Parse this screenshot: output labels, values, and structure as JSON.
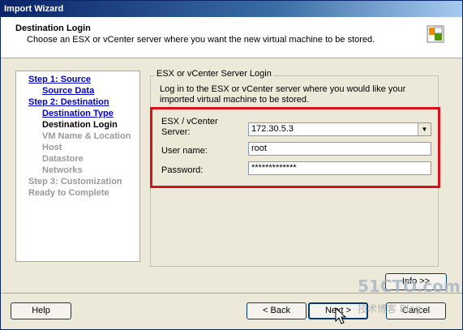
{
  "window": {
    "title": "Import Wizard"
  },
  "header": {
    "title": "Destination Login",
    "subtitle": "Choose an ESX or vCenter server where you want the new virtual machine to be stored."
  },
  "steps": [
    {
      "label": "Step 1: Source",
      "state": "link"
    },
    {
      "label": "Source Data",
      "state": "link"
    },
    {
      "label": "Step 2: Destination",
      "state": "link"
    },
    {
      "label": "Destination Type",
      "state": "link"
    },
    {
      "label": "Destination Login",
      "state": "current"
    },
    {
      "label": "VM Name & Location",
      "state": "disabled"
    },
    {
      "label": "Host",
      "state": "disabled"
    },
    {
      "label": "Datastore",
      "state": "disabled"
    },
    {
      "label": "Networks",
      "state": "disabled"
    },
    {
      "label": "Step 3: Customization",
      "state": "disabled"
    },
    {
      "label": "Ready to Complete",
      "state": "disabled"
    }
  ],
  "login": {
    "group_title": "ESX or vCenter Server Login",
    "description": "Log in to the ESX or vCenter server where you would like your imported virtual machine to be stored.",
    "server_label_1": "ESX / vCenter",
    "server_label_2": "Server:",
    "server_value": "172.30.5.3",
    "username_label": "User name:",
    "username_value": "root",
    "password_label": "Password:",
    "password_value": "*************"
  },
  "buttons": {
    "info": "Info >>",
    "help": "Help",
    "back": "< Back",
    "next": "Next >",
    "cancel": "Cancel"
  },
  "watermark": {
    "line1": "51CTO.com",
    "line2": "技术博客 Blog"
  }
}
